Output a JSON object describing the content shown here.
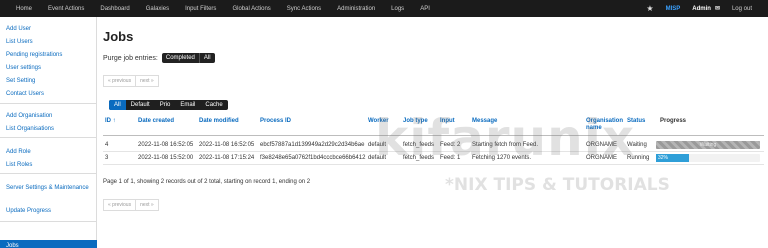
{
  "topnav": {
    "items": [
      "Home",
      "Event Actions",
      "Dashboard",
      "Galaxies",
      "Input Filters",
      "Global Actions",
      "Sync Actions",
      "Administration",
      "Logs",
      "API"
    ],
    "org": "MISP",
    "user": "Admin",
    "logout": "Log out"
  },
  "sidebar": {
    "items": [
      "Add User",
      "List Users",
      "Pending registrations",
      "User settings",
      "Set Setting",
      "Contact Users",
      "Add Organisation",
      "List Organisations",
      "Add Role",
      "List Roles",
      "Server Settings & Maintenance",
      "Update Progress",
      "Jobs"
    ]
  },
  "main": {
    "title": "Jobs",
    "purge_label": "Purge job entries:",
    "purge_buttons": [
      "Completed",
      "All"
    ],
    "pager": {
      "previous": "« previous",
      "next": "next »"
    },
    "filters": [
      "All",
      "Default",
      "Prio",
      "Email",
      "Cache"
    ],
    "columns": [
      "ID ↑",
      "Date created",
      "Date modified",
      "Process ID",
      "Worker",
      "Job type",
      "Input",
      "Message",
      "Organisation name",
      "Status",
      "Progress"
    ],
    "rows": [
      {
        "id": "4",
        "created": "2022-11-08 16:52:05",
        "modified": "2022-11-08 16:52:05",
        "process_id": "ebcf57887a1d139949a2d29c2d34b6ae",
        "worker": "default",
        "job_type": "fetch_feeds",
        "input": "Feed: 2",
        "message": "Starting fetch from Feed.",
        "org": "ORGNAME",
        "status": "Waiting",
        "progress_label": "Waiting",
        "progress": 1.0
      },
      {
        "id": "3",
        "created": "2022-11-08 15:52:00",
        "modified": "2022-11-08 17:15:24",
        "process_id": "f3e8248e65a0762f1bd4cccbce66b6412",
        "worker": "default",
        "job_type": "fetch_feeds",
        "input": "Feed: 1",
        "message": "Fetching 1270 events.",
        "org": "ORGNAME",
        "status": "Running",
        "progress_label": "32%",
        "progress": 0.32
      }
    ],
    "summary": "Page 1 of 1, showing 2 records out of 2 total, starting on record 1, ending on 2"
  },
  "watermark": {
    "name": "kifarunix",
    "tagline": "*NIX TIPS & TUTORIALS"
  },
  "colors": {
    "link": "#0a6bbf",
    "topbar": "#1b1b1b",
    "progress": "#2f9fd8"
  }
}
